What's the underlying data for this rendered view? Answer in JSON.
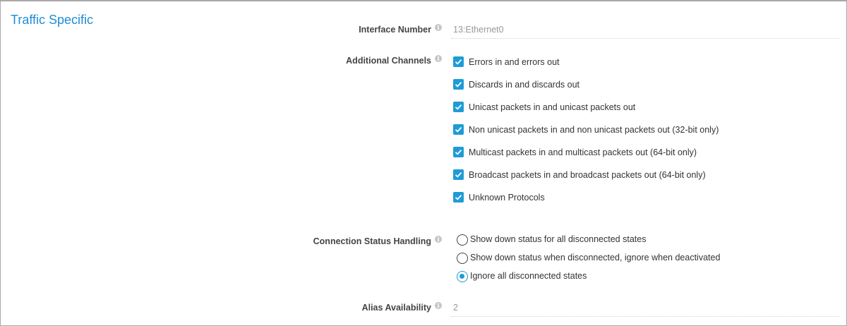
{
  "section": {
    "title": "Traffic Specific"
  },
  "interface_number": {
    "label": "Interface Number",
    "value": "13:Ethernet0",
    "info_icon": "info-icon"
  },
  "additional_channels": {
    "label": "Additional Channels",
    "options": [
      {
        "label": "Errors in and errors out",
        "checked": true
      },
      {
        "label": "Discards in and discards out",
        "checked": true
      },
      {
        "label": "Unicast packets in and unicast packets out",
        "checked": true
      },
      {
        "label": "Non unicast packets in and non unicast packets out (32-bit only)",
        "checked": true
      },
      {
        "label": "Multicast packets in and multicast packets out (64-bit only)",
        "checked": true
      },
      {
        "label": "Broadcast packets in and broadcast packets out (64-bit only)",
        "checked": true
      },
      {
        "label": "Unknown Protocols",
        "checked": true
      }
    ]
  },
  "connection_status": {
    "label": "Connection Status Handling",
    "options": [
      {
        "label": "Show down status for all disconnected states",
        "selected": false
      },
      {
        "label": "Show down status when disconnected, ignore when deactivated",
        "selected": false
      },
      {
        "label": "Ignore all disconnected states",
        "selected": true
      }
    ]
  },
  "alias_availability": {
    "label": "Alias Availability",
    "value": "2"
  },
  "colors": {
    "accent": "#1f9bd6",
    "title": "#1f8dd6"
  }
}
